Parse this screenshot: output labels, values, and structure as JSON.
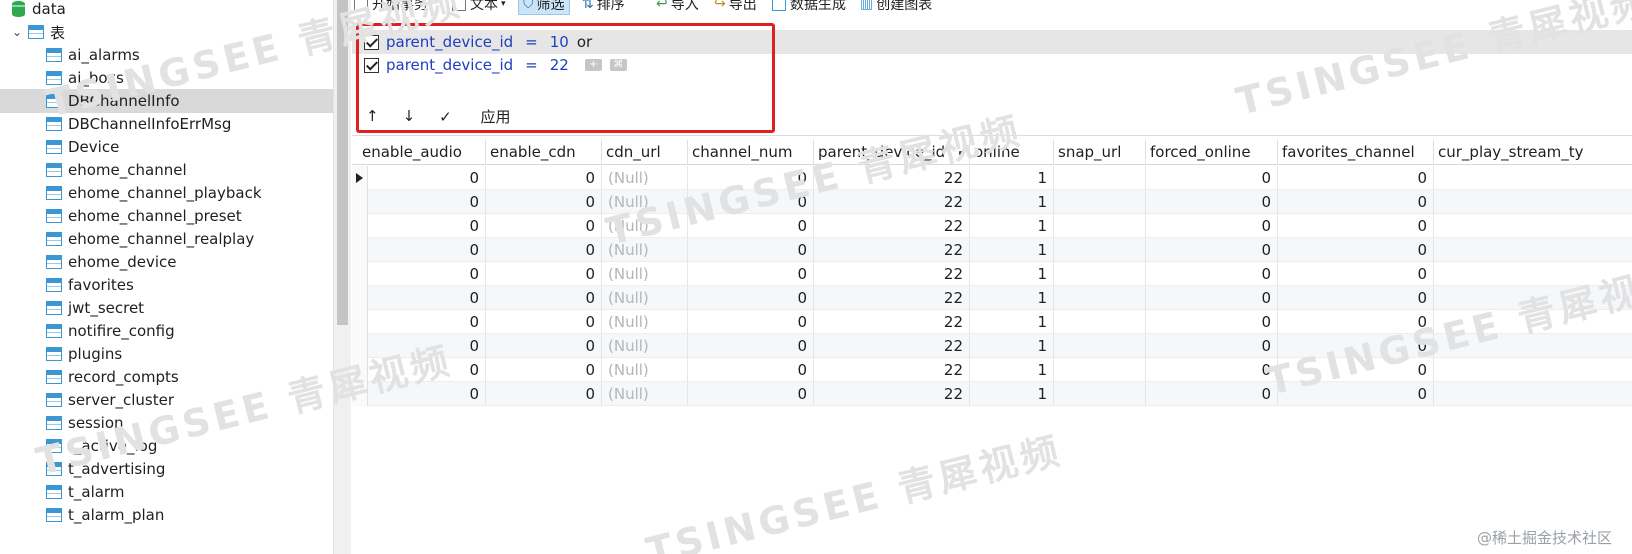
{
  "tree": {
    "db_name": "data",
    "group_label": "表",
    "tables": [
      "ai_alarms",
      "ai_boxs",
      "DBChannelInfo",
      "DBChannelInfoErrMsg",
      "Device",
      "ehome_channel",
      "ehome_channel_playback",
      "ehome_channel_preset",
      "ehome_channel_realplay",
      "ehome_device",
      "favorites",
      "jwt_secret",
      "notifire_config",
      "plugins",
      "record_compts",
      "server_cluster",
      "session",
      "t_active_log",
      "t_advertising",
      "t_alarm",
      "t_alarm_plan"
    ],
    "selected": "DBChannelInfo"
  },
  "toolbar": {
    "begin_tx": "开始事务",
    "text": "文本",
    "filter": "筛选",
    "sort": "排序",
    "import": "导入",
    "export": "导出",
    "datagen": "数据生成",
    "create_chart": "创建图表"
  },
  "filter": {
    "conditions": [
      {
        "field": "parent_device_id",
        "op": "=",
        "value": "10",
        "join": "or"
      },
      {
        "field": "parent_device_id",
        "op": "=",
        "value": "22",
        "join": ""
      }
    ],
    "move_up": "↑",
    "move_down": "↓",
    "apply_label": "应用",
    "apply_check": "✓"
  },
  "grid": {
    "columns": [
      "enable_audio",
      "enable_cdn",
      "cdn_url",
      "channel_num",
      "parent_device_id",
      "online",
      "snap_url",
      "forced_online",
      "favorites_channel",
      "cur_play_stream_ty"
    ],
    "rows": [
      [
        "0",
        "0",
        "(Null)",
        "0",
        "22",
        "1",
        "",
        "0",
        "0",
        ""
      ],
      [
        "0",
        "0",
        "(Null)",
        "0",
        "22",
        "1",
        "",
        "0",
        "0",
        ""
      ],
      [
        "0",
        "0",
        "(Null)",
        "0",
        "22",
        "1",
        "",
        "0",
        "0",
        ""
      ],
      [
        "0",
        "0",
        "(Null)",
        "0",
        "22",
        "1",
        "",
        "0",
        "0",
        ""
      ],
      [
        "0",
        "0",
        "(Null)",
        "0",
        "22",
        "1",
        "",
        "0",
        "0",
        ""
      ],
      [
        "0",
        "0",
        "(Null)",
        "0",
        "22",
        "1",
        "",
        "0",
        "0",
        ""
      ],
      [
        "0",
        "0",
        "(Null)",
        "0",
        "22",
        "1",
        "",
        "0",
        "0",
        ""
      ],
      [
        "0",
        "0",
        "(Null)",
        "0",
        "22",
        "1",
        "",
        "0",
        "0",
        ""
      ],
      [
        "0",
        "0",
        "(Null)",
        "0",
        "22",
        "1",
        "",
        "0",
        "0",
        ""
      ],
      [
        "0",
        "0",
        "(Null)",
        "0",
        "22",
        "1",
        "",
        "0",
        "0",
        ""
      ]
    ]
  },
  "watermark": "TSINGSEE 青犀视频",
  "credit": "@稀土掘金技术社区",
  "colors": {
    "accent": "#3b97d3",
    "highlight": "#e02020",
    "filter_text": "#1f3fbf"
  }
}
